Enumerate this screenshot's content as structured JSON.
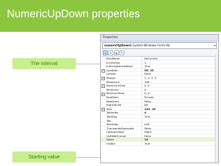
{
  "banner": {
    "title": "NumericUpDown properties"
  },
  "callouts": {
    "interval": "The interval",
    "starting": "Starting value"
  },
  "properties_window": {
    "title": "Properties",
    "object_name": "numericUpDown1",
    "object_type": "System.Windows.Forms.Nu",
    "toolbar_icons": [
      "categorized-icon",
      "alphabetical-icon",
      "properties-icon",
      "events-icon"
    ],
    "rows": [
      {
        "name": "BindMode",
        "value": "NoControl"
      },
      {
        "name": "Increment",
        "value": "1"
      },
      {
        "name": "InterceptArrowKeys",
        "value": "True"
      },
      {
        "name": "Location",
        "value": "56, 35",
        "expandable": true,
        "bold": true
      },
      {
        "name": "Locked",
        "value": "False"
      },
      {
        "name": "Margin",
        "value": "3, 3, 3, 3",
        "expandable": true
      },
      {
        "name": "Maximum",
        "value": "100"
      },
      {
        "name": "MaximumSize",
        "value": "0, 0",
        "expandable": true
      },
      {
        "name": "Minimum",
        "value": "0"
      },
      {
        "name": "MinimumSize",
        "value": "0, 0",
        "expandable": true
      },
      {
        "name": "Modifiers",
        "value": "Private"
      },
      {
        "name": "ReadOnly",
        "value": "False"
      },
      {
        "name": "RightToLeft",
        "value": "No"
      },
      {
        "name": "Size",
        "value": "120, 20",
        "expandable": true,
        "bold": true
      },
      {
        "name": "TabIndex",
        "value": "4",
        "bold": true
      },
      {
        "name": "TabStop",
        "value": "True"
      },
      {
        "name": "Tag",
        "value": ""
      },
      {
        "name": "TextAlign",
        "value": "Left"
      },
      {
        "name": "ThousandsSeparator",
        "value": "False"
      },
      {
        "name": "UpDownAlign",
        "value": "Right"
      },
      {
        "name": "UseWaitCursor",
        "value": "False"
      },
      {
        "name": "Value",
        "value": "10",
        "bold": true,
        "highlight": true
      },
      {
        "name": "Visible",
        "value": "True"
      }
    ]
  },
  "colors": {
    "banner": "#8cc63f",
    "callout_bg": "#c7ee8f",
    "callout_text": "#3f7a16"
  }
}
